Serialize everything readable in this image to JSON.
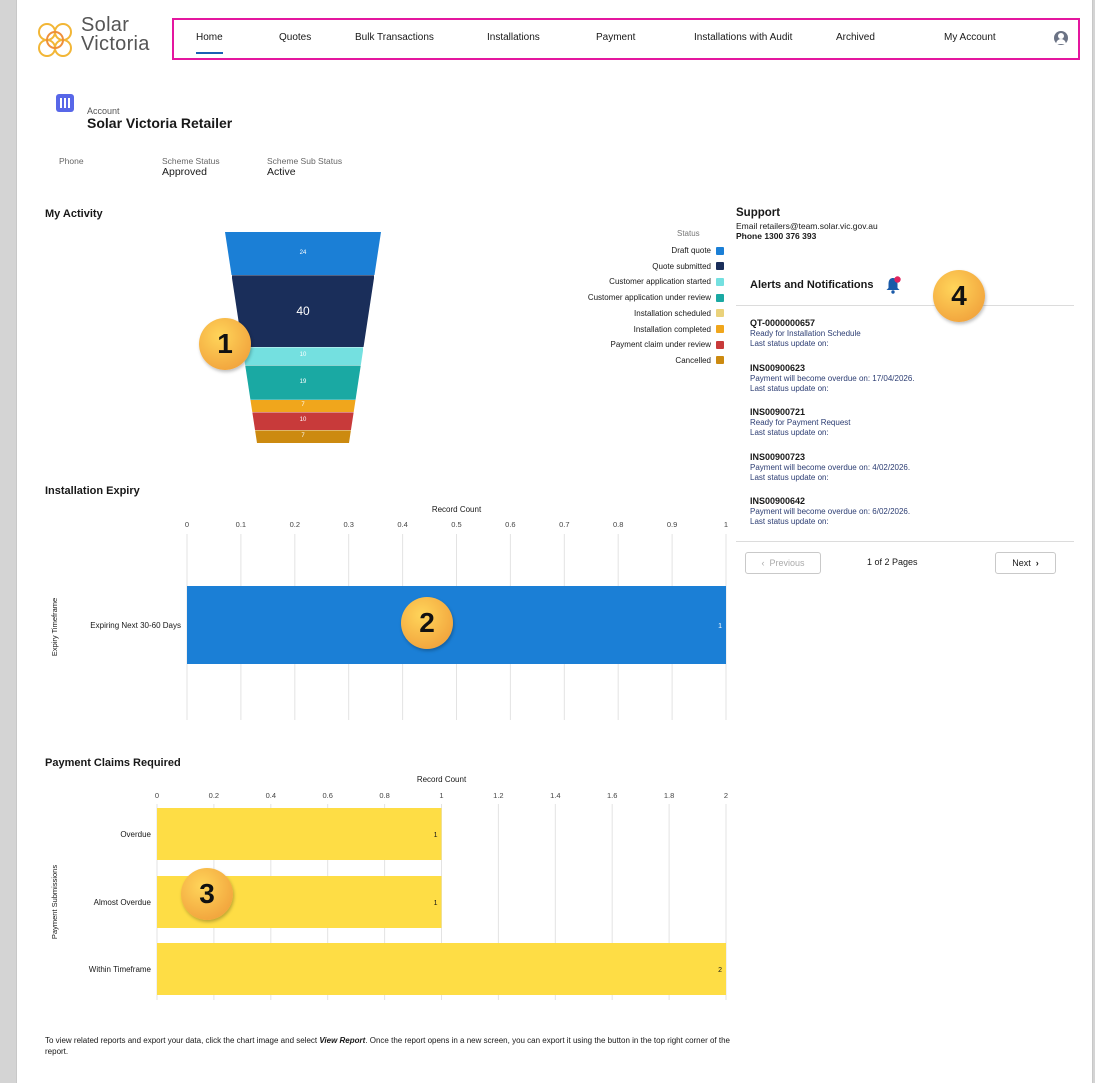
{
  "header": {
    "logo_line1": "Solar",
    "logo_line2": "Victoria",
    "nav": [
      {
        "label": "Home",
        "active": true
      },
      {
        "label": "Quotes"
      },
      {
        "label": "Bulk Transactions"
      },
      {
        "label": "Installations"
      },
      {
        "label": "Payment"
      },
      {
        "label": "Installations with Audit"
      },
      {
        "label": "Archived"
      },
      {
        "label": "My Account"
      }
    ],
    "user_icon": "user-avatar-icon"
  },
  "account": {
    "type_label": "Account",
    "name": "Solar Victoria Retailer",
    "fields": [
      {
        "label": "Phone",
        "value": ""
      },
      {
        "label": "Scheme Status",
        "value": "Approved"
      },
      {
        "label": "Scheme Sub Status",
        "value": "Active"
      }
    ]
  },
  "activity": {
    "title": "My Activity",
    "legend_title": "Status"
  },
  "expiry": {
    "title": "Installation Expiry"
  },
  "payments": {
    "title": "Payment Claims Required"
  },
  "chart_data": [
    {
      "type": "funnel",
      "legend_title": "Status",
      "categories": [
        "Draft quote",
        "Quote submitted",
        "Customer application started",
        "Customer application under review",
        "Installation scheduled",
        "Installation completed",
        "Payment claim under review",
        "Cancelled"
      ],
      "values": [
        24,
        40,
        10,
        19,
        null,
        7,
        10,
        7
      ],
      "colors": [
        "#1b7fd6",
        "#1a2e5a",
        "#74e0e0",
        "#1aa9a3",
        "#ead27b",
        "#f0a61c",
        "#c83a3a",
        "#cc8a10"
      ]
    },
    {
      "type": "bar",
      "orientation": "horizontal",
      "xlabel": "Record Count",
      "ylabel": "Expiry Timeframe",
      "xlim": [
        0,
        1
      ],
      "ticks": [
        "0",
        "0.1",
        "0.2",
        "0.3",
        "0.4",
        "0.5",
        "0.6",
        "0.7",
        "0.8",
        "0.9",
        "1"
      ],
      "categories": [
        "Expiring Next 30-60 Days"
      ],
      "values": [
        1
      ],
      "color": "#1b7fd6"
    },
    {
      "type": "bar",
      "orientation": "horizontal",
      "xlabel": "Record Count",
      "ylabel": "Payment Submissions",
      "xlim": [
        0,
        2
      ],
      "ticks": [
        "0",
        "0.2",
        "0.4",
        "0.6",
        "0.8",
        "1",
        "1.2",
        "1.4",
        "1.6",
        "1.8",
        "2"
      ],
      "categories": [
        "Overdue",
        "Almost Overdue",
        "Within Timeframe"
      ],
      "values": [
        1,
        1,
        2
      ],
      "color": "#fedd45"
    }
  ],
  "support": {
    "title": "Support",
    "email": "Email retailers@team.solar.vic.gov.au",
    "phone": "Phone 1300 376 393"
  },
  "alerts": {
    "title": "Alerts and Notifications",
    "items": [
      {
        "id": "QT-0000000657",
        "message": "Ready for Installation Schedule",
        "update": "Last status update on:"
      },
      {
        "id": "INS00900623",
        "message": "Payment will become overdue on: 17/04/2026.",
        "update": "Last status update on:"
      },
      {
        "id": "INS00900721",
        "message": "Ready for Payment Request",
        "update": "Last status update on:"
      },
      {
        "id": "INS00900723",
        "message": "Payment will become overdue on: 4/02/2026.",
        "update": "Last status update on:"
      },
      {
        "id": "INS00900642",
        "message": "Payment will become overdue on: 6/02/2026.",
        "update": "Last status update on:"
      }
    ],
    "previous_label": "Previous",
    "next_label": "Next",
    "pages": "1 of 2 Pages"
  },
  "callouts": [
    "1",
    "2",
    "3",
    "4"
  ],
  "footer": {
    "text_before": "To view related reports and export your data, click the chart image and select ",
    "text_em": "View Report",
    "text_after": ". Once the report opens in a new screen, you can export it using the button in the top right corner of the report."
  }
}
